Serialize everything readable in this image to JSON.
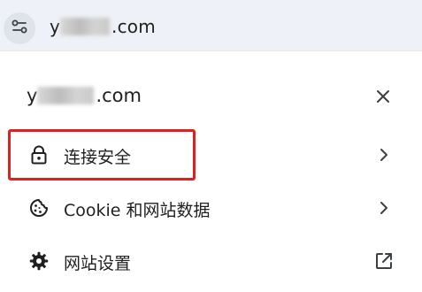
{
  "address_bar": {
    "url_prefix_visible": "y",
    "url_suffix": ".com",
    "site_info_icon": "tune-icon"
  },
  "panel": {
    "title_prefix_visible": "y",
    "title_suffix": ".com",
    "close_icon": "close-icon",
    "items": [
      {
        "label": "连接安全",
        "icon": "lock-icon",
        "trailing_icon": "chevron-right-icon"
      },
      {
        "label": "Cookie 和网站数据",
        "icon": "cookie-icon",
        "trailing_icon": "chevron-right-icon"
      },
      {
        "label": "网站设置",
        "icon": "gear-icon",
        "trailing_icon": "open-in-new-icon"
      }
    ]
  },
  "annotation": {
    "highlight_color": "#e0201f",
    "highlighted_item": "连接安全"
  }
}
